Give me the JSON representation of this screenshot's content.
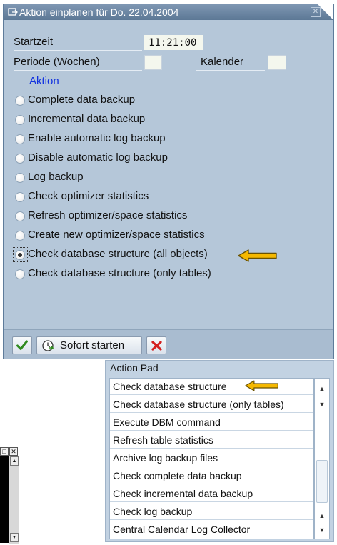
{
  "dialog": {
    "title": "Aktion einplanen für Do.  22.04.2004",
    "fields": {
      "start_time_label": "Startzeit",
      "start_time_value": "11:21:00",
      "period_label": "Periode (Wochen)",
      "calendar_label": "Kalender"
    },
    "group_label": "Aktion",
    "options": [
      {
        "label": "Complete data backup",
        "selected": false
      },
      {
        "label": "Incremental data backup",
        "selected": false
      },
      {
        "label": "Enable automatic log backup",
        "selected": false
      },
      {
        "label": "Disable automatic log backup",
        "selected": false
      },
      {
        "label": "Log backup",
        "selected": false
      },
      {
        "label": "Check optimizer statistics",
        "selected": false
      },
      {
        "label": "Refresh optimizer/space statistics",
        "selected": false
      },
      {
        "label": "Create new optimizer/space statistics",
        "selected": false
      },
      {
        "label": "Check database structure (all objects)",
        "selected": true
      },
      {
        "label": "Check database structure (only tables)",
        "selected": false
      }
    ],
    "footer": {
      "start_now_label": "Sofort starten"
    }
  },
  "action_pad": {
    "header": "Action Pad",
    "items": [
      "Check database structure",
      "Check database structure (only tables)",
      "Execute DBM command",
      "Refresh table statistics",
      "Archive log backup files",
      "Check complete data backup",
      "Check incremental data backup",
      "Check log backup",
      "Central Calendar Log Collector"
    ]
  },
  "colors": {
    "dialog_bg": "#b5c7d9",
    "titlebar": "#6b86a4",
    "group_label": "#1030e0",
    "arrow_fill": "#f5b800",
    "arrow_stroke": "#6a5200",
    "check_green": "#2f8a1e",
    "cancel_red": "#d42020"
  },
  "icons": {
    "title": "dialog-icon",
    "close": "close-icon",
    "continue": "checkmark-icon",
    "start_now": "clock-icon",
    "cancel": "cancel-x-icon",
    "pointer": "left-arrow-icon"
  }
}
